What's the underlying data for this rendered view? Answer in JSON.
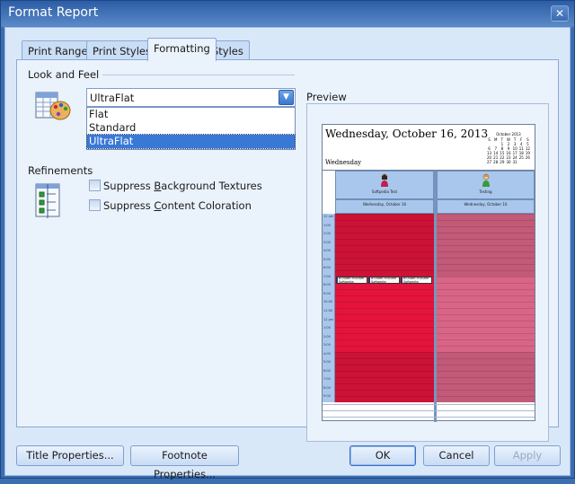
{
  "window": {
    "title": "Format Report",
    "close_label": "✕"
  },
  "tabs": [
    {
      "label": "Print Ranges"
    },
    {
      "label": "Print Styles"
    },
    {
      "label": "Formatting"
    },
    {
      "label": "Styles"
    }
  ],
  "look_and_feel": {
    "label": "Look and Feel",
    "selected": "UltraFlat",
    "options": [
      "Flat",
      "Standard",
      "UltraFlat"
    ]
  },
  "refinements": {
    "label": "Refinements",
    "suppress_textures": {
      "prefix": "Suppress ",
      "underline": "B",
      "rest": "ackground Textures"
    },
    "suppress_coloration": {
      "prefix": "Suppress ",
      "underline": "C",
      "rest": "ontent Coloration"
    }
  },
  "preview": {
    "label": "Preview",
    "date_heading": "Wednesday, October 16, 2013",
    "day_label": "Wednesday",
    "mini_calendar": {
      "title": "October 2013",
      "headers": [
        "S",
        "M",
        "T",
        "W",
        "T",
        "F",
        "S"
      ],
      "days": [
        "",
        "",
        "1",
        "2",
        "3",
        "4",
        "5",
        "6",
        "7",
        "8",
        "9",
        "10",
        "11",
        "12",
        "13",
        "14",
        "15",
        "16",
        "17",
        "18",
        "19",
        "20",
        "21",
        "22",
        "23",
        "24",
        "25",
        "26",
        "27",
        "28",
        "29",
        "30",
        "31",
        "",
        ""
      ]
    },
    "resources": [
      {
        "name": "Softpedia Test",
        "date": "Wednesday, October 16",
        "color": "#cc1236"
      },
      {
        "name": "Testing",
        "date": "Wednesday, October 16",
        "color": "#c25a78"
      }
    ],
    "times": [
      "12 am",
      "1:00",
      "2:00",
      "3:00",
      "4:00",
      "5:00",
      "6:00",
      "7:00",
      "8:00",
      "9:00",
      "10:00",
      "11:00",
      "12 pm",
      "1:00",
      "2:00",
      "3:00",
      "4:00",
      "5:00",
      "6:00",
      "7:00",
      "8:00",
      "9:00"
    ],
    "appointments": [
      {
        "time": "8:00am-9:00am",
        "text": "Softpedia"
      },
      {
        "time": "8:00am-9:00am",
        "text": "Softpedia"
      },
      {
        "time": "8:00am-9:00am",
        "text": "Softpedia"
      }
    ]
  },
  "buttons": {
    "title_properties": "Title Properties...",
    "footnote_properties": "Footnote Properties...",
    "ok": "OK",
    "cancel": "Cancel",
    "apply": "Apply"
  }
}
